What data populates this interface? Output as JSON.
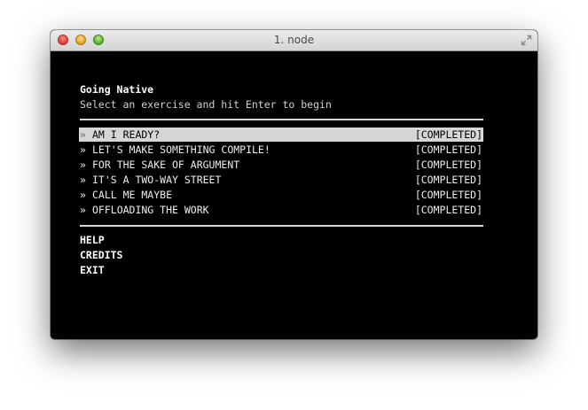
{
  "window": {
    "title": "1. node"
  },
  "header": {
    "title": "Going Native",
    "subtitle": "Select an exercise and hit Enter to begin"
  },
  "menu": {
    "arrow_glyph": "»",
    "items": [
      {
        "label": "AM I READY?",
        "status": "[COMPLETED]",
        "selected": true
      },
      {
        "label": "LET'S MAKE SOMETHING COMPILE!",
        "status": "[COMPLETED]",
        "selected": false
      },
      {
        "label": "FOR THE SAKE OF ARGUMENT",
        "status": "[COMPLETED]",
        "selected": false
      },
      {
        "label": "IT'S A TWO-WAY STREET",
        "status": "[COMPLETED]",
        "selected": false
      },
      {
        "label": "CALL ME MAYBE",
        "status": "[COMPLETED]",
        "selected": false
      },
      {
        "label": "OFFLOADING THE WORK",
        "status": "[COMPLETED]",
        "selected": false
      }
    ]
  },
  "extras": {
    "help": "HELP",
    "credits": "CREDITS",
    "exit": "EXIT"
  },
  "colors": {
    "terminal_bg": "#000000",
    "selected_bg": "#d6d6d6",
    "close": "#e0443e",
    "minimize": "#e8a626",
    "zoom": "#5fb636"
  }
}
